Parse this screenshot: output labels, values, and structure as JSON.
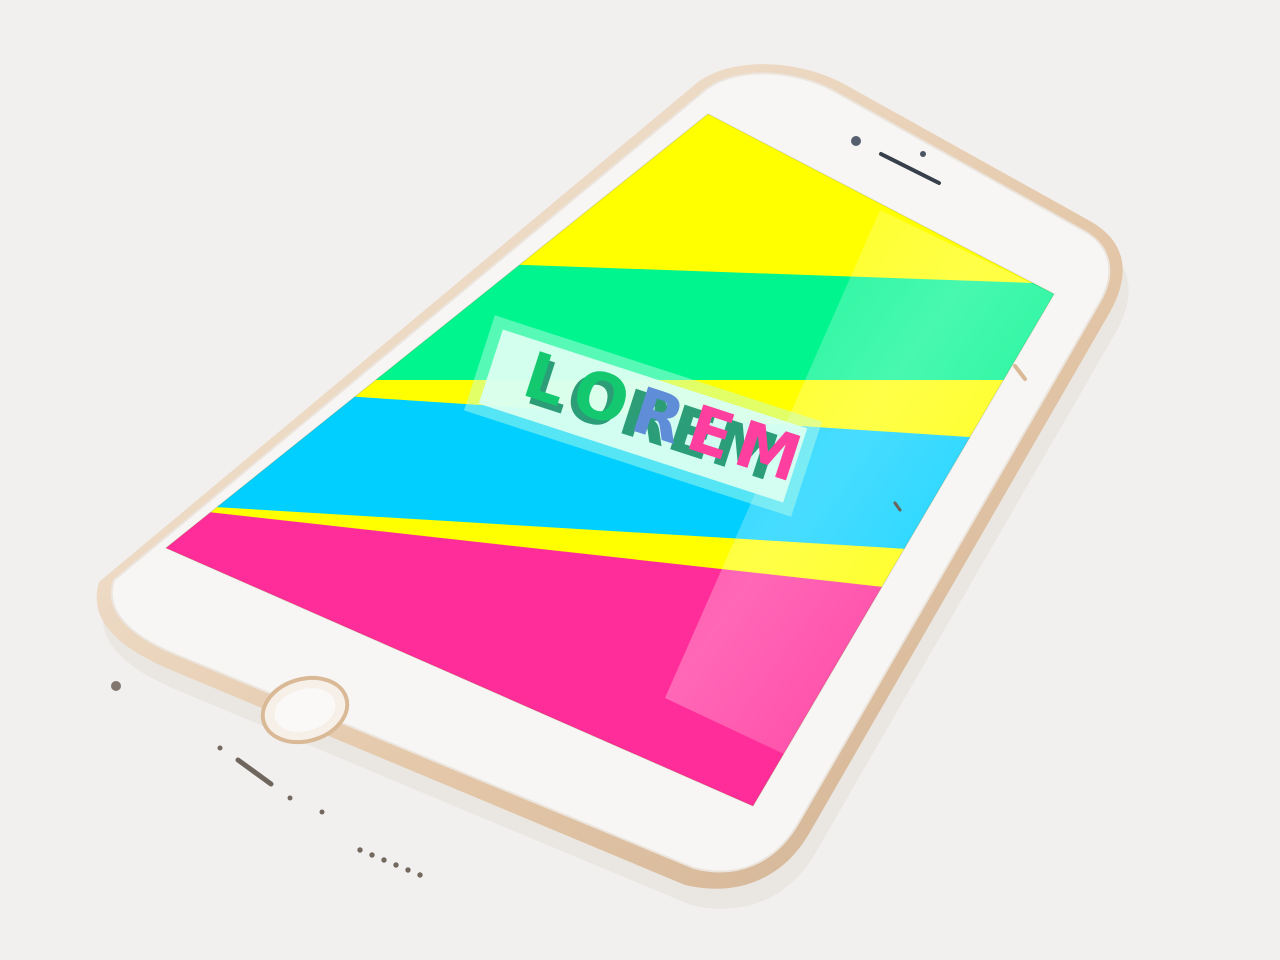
{
  "scene": {
    "background": "#f1f0ee",
    "device": {
      "type": "smartphone",
      "orientation": "tilted",
      "frame_color": "#f7f6f4",
      "edge_color": "#e7d2b8",
      "accent_color": "#d9b996",
      "parts": [
        "front-camera-icon",
        "earpiece-speaker-icon",
        "proximity-sensor-icon",
        "home-button-icon",
        "volume-button-icon",
        "power-button-icon",
        "headphone-jack-icon",
        "speaker-grille-icon",
        "lightning-port-icon"
      ]
    },
    "screen": {
      "stripes": [
        {
          "name": "yellow-stripe",
          "color": "#ffff00"
        },
        {
          "name": "green-stripe",
          "color": "#00f58f"
        },
        {
          "name": "blue-stripe",
          "color": "#00cfff"
        },
        {
          "name": "pink-stripe",
          "color": "#ff2d9a"
        }
      ],
      "logo": {
        "text": "LOREM",
        "box_color": "#d9fff1",
        "letter_colors": [
          "#13c86f",
          "#13c86f",
          "#5f8dd8",
          "#ff3f9f",
          "#ff3f9f"
        ]
      }
    }
  }
}
